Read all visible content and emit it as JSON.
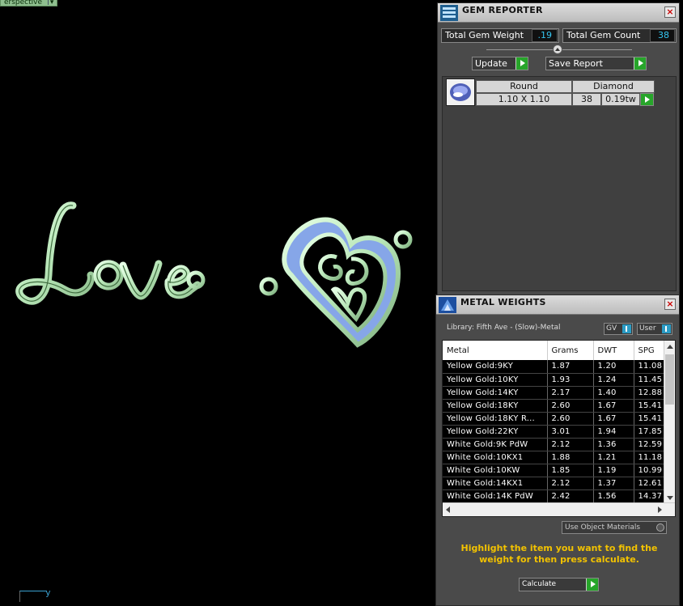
{
  "viewport": {
    "tab_label": "erspective",
    "axis_label": "y"
  },
  "gem_reporter": {
    "title": "GEM REPORTER",
    "total_weight_label": "Total Gem Weight",
    "total_weight_value": ".19",
    "total_count_label": "Total Gem Count",
    "total_count_value": "38",
    "update_label": "Update",
    "save_report_label": "Save Report",
    "gems": [
      {
        "shape": "Round",
        "material": "Diamond",
        "size": "1.10 X 1.10",
        "count": "38",
        "weight": "0.19tw"
      }
    ]
  },
  "metal_weights": {
    "title": "METAL WEIGHTS",
    "library": "Library: Fifth Ave - (Slow)-Metal",
    "gv_label": "GV",
    "user_label": "User",
    "columns": [
      "Metal",
      "Grams",
      "DWT",
      "SPG"
    ],
    "rows": [
      [
        "Yellow Gold:9KY",
        "1.87",
        "1.20",
        "11.08"
      ],
      [
        "Yellow Gold:10KY",
        "1.93",
        "1.24",
        "11.45"
      ],
      [
        "Yellow Gold:14KY",
        "2.17",
        "1.40",
        "12.88"
      ],
      [
        "Yellow Gold:18KY",
        "2.60",
        "1.67",
        "15.41"
      ],
      [
        "Yellow Gold:18KY R...",
        "2.60",
        "1.67",
        "15.41"
      ],
      [
        "Yellow Gold:22KY",
        "3.01",
        "1.94",
        "17.85"
      ],
      [
        "White Gold:9K PdW",
        "2.12",
        "1.36",
        "12.59"
      ],
      [
        "White Gold:10KX1",
        "1.88",
        "1.21",
        "11.18"
      ],
      [
        "White Gold:10KW",
        "1.85",
        "1.19",
        "10.99"
      ],
      [
        "White Gold:14KX1",
        "2.12",
        "1.37",
        "12.61"
      ],
      [
        "White Gold:14K PdW",
        "2.42",
        "1.56",
        "14.37"
      ]
    ],
    "use_object_materials_label": "Use Object Materials",
    "hint": "Highlight the item you want to find the weight for then press calculate.",
    "calculate_label": "Calculate"
  }
}
